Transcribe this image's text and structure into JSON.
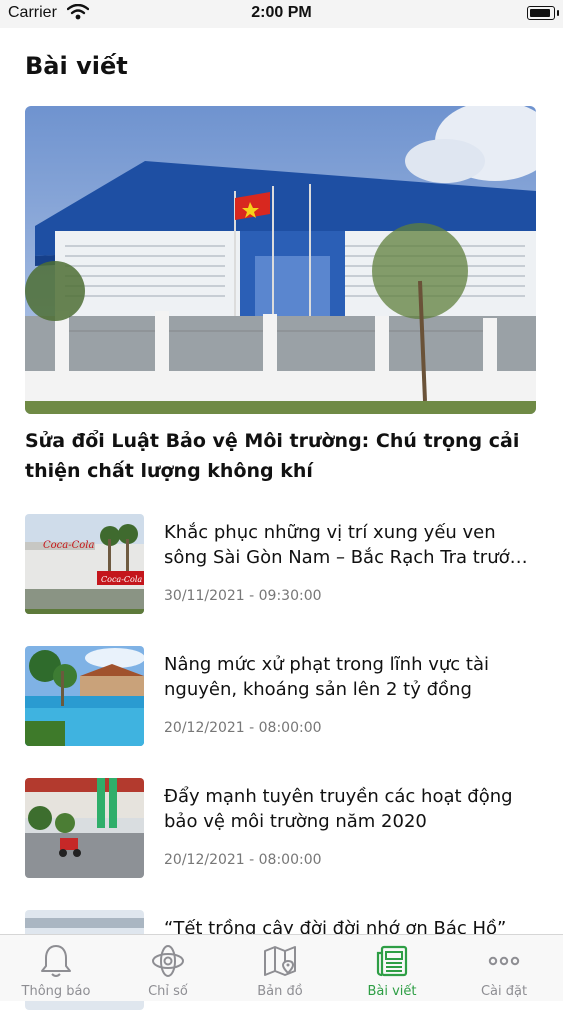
{
  "status_bar": {
    "carrier": "Carrier",
    "time": "2:00 PM"
  },
  "page_title": "Bài viết",
  "featured": {
    "title": "Sửa đổi Luật Bảo vệ Môi trường: Chú trọng cải thiện chất lượng không khí"
  },
  "articles": [
    {
      "title": "Khắc phục những vị trí xung yếu ven sông Sài Gòn Nam – Bắc Rạch Tra trước mùa mưa lũ",
      "date": "30/11/2021 - 09:30:00"
    },
    {
      "title": "Nâng mức xử phạt trong lĩnh vực tài nguyên, khoáng sản lên 2 tỷ đồng",
      "date": "20/12/2021 - 08:00:00"
    },
    {
      "title": "Đẩy mạnh tuyên truyền các hoạt động bảo vệ môi trường năm 2020",
      "date": "20/12/2021 - 08:00:00"
    },
    {
      "title": "“Tết trồng cây đời đời nhớ ơn Bác Hồ”",
      "date": ""
    }
  ],
  "tabs": [
    {
      "label": "Thông báo",
      "icon": "bell-icon"
    },
    {
      "label": "Chỉ số",
      "icon": "atom-icon"
    },
    {
      "label": "Bản đồ",
      "icon": "map-icon"
    },
    {
      "label": "Bài viết",
      "icon": "newspaper-icon",
      "active": true
    },
    {
      "label": "Cài đặt",
      "icon": "more-icon"
    }
  ],
  "colors": {
    "accent": "#2e9e45",
    "inactive": "#8e8e93"
  }
}
